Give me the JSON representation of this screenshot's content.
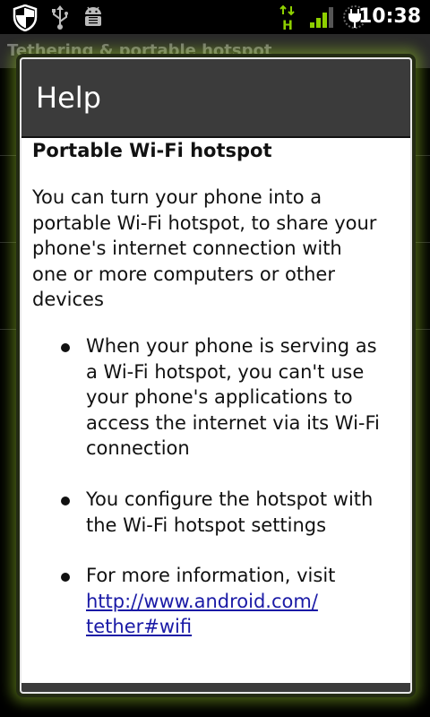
{
  "status_bar": {
    "time": "10:38",
    "network_type": "H",
    "icons": [
      "shield-icon",
      "usb-icon",
      "android-debug-icon",
      "data-activity-icon",
      "signal-strength-icon",
      "battery-charging-icon"
    ]
  },
  "background_app": {
    "title": "Tethering & portable hotspot"
  },
  "dialog": {
    "title": "Help",
    "heading": "Portable Wi-Fi hotspot",
    "intro_line1": "You can turn your phone into a",
    "intro_line2": "portable Wi-Fi hotspot, to share your",
    "intro_line3": "phone's internet connection with",
    "intro_line4": "one or more computers or other",
    "intro_line5": "devices",
    "bullets": [
      {
        "lines": [
          "When your phone is serving as",
          "a Wi-Fi hotspot, you can't use",
          "your phone's applications to",
          "access the internet via its Wi-Fi",
          "connection"
        ]
      },
      {
        "lines": [
          "You configure the hotspot with",
          "the Wi-Fi hotspot settings"
        ]
      },
      {
        "text": "For more information, visit",
        "link_line1": "http://www.android.com/",
        "link_line2": "tether#wifi"
      }
    ]
  },
  "colors": {
    "dialog_header": "#3b3b3b",
    "glow": "#96c828",
    "link": "#1a1aa6",
    "hspa_green": "#8ed000"
  }
}
